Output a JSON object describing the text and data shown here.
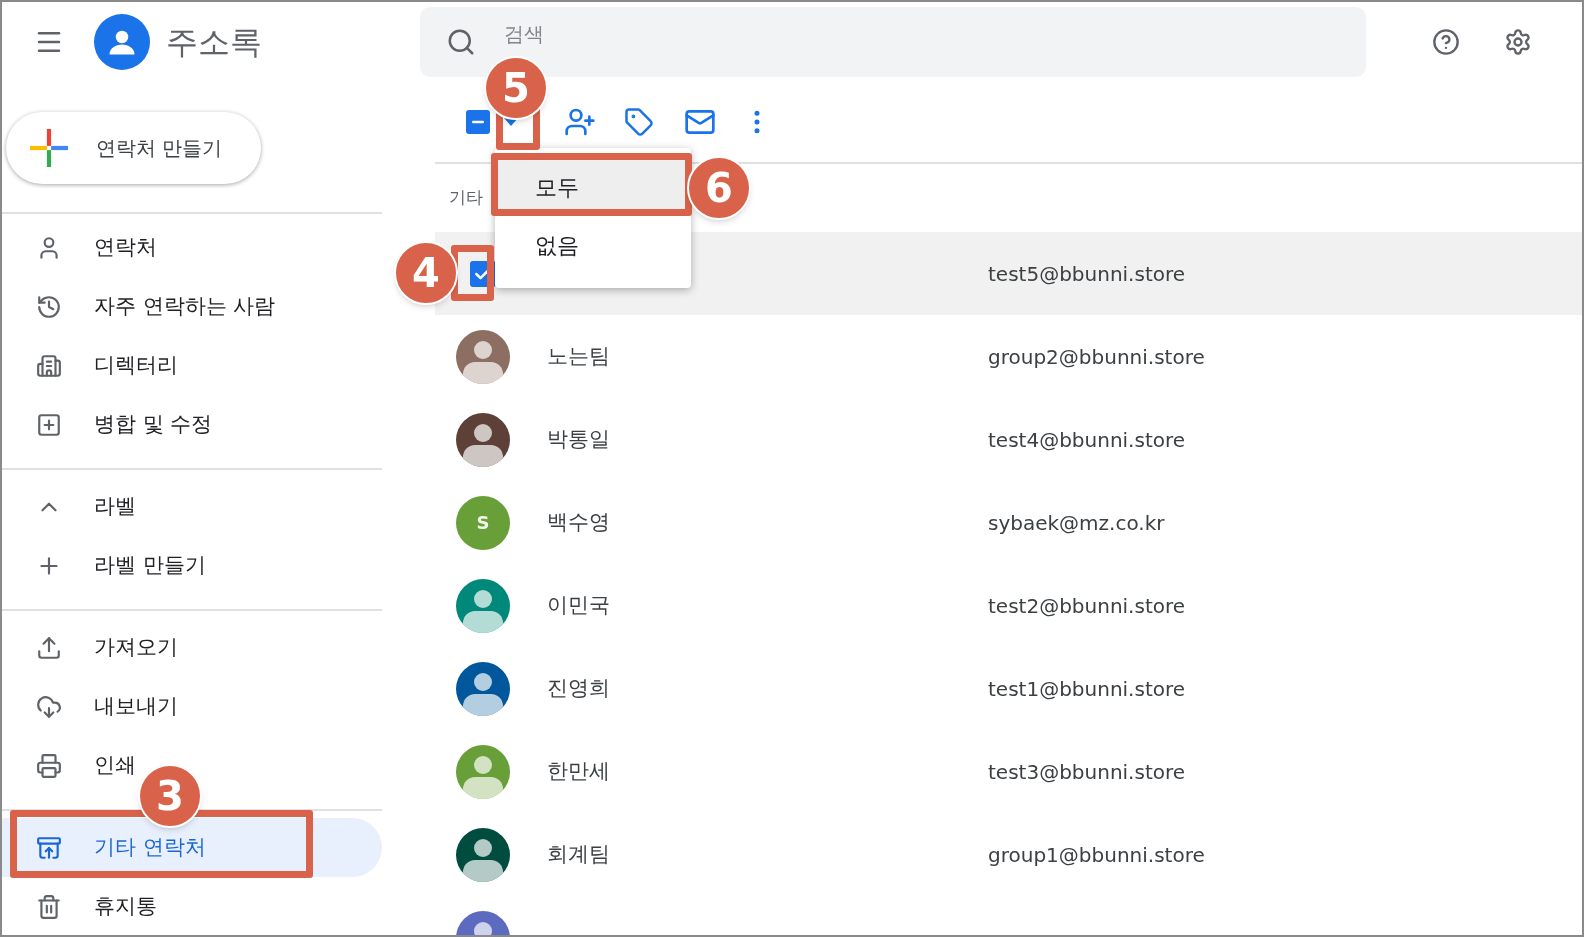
{
  "app": {
    "title": "주소록"
  },
  "search": {
    "placeholder": "검색"
  },
  "create_button": {
    "label": "연락처 만들기"
  },
  "sidebar": {
    "groups": [
      {
        "items": [
          {
            "label": "연락처",
            "selected": false
          },
          {
            "label": "자주 연락하는 사람",
            "selected": false
          },
          {
            "label": "디렉터리",
            "selected": false
          },
          {
            "label": "병합 및 수정",
            "selected": false
          }
        ]
      },
      {
        "items": [
          {
            "label": "라벨",
            "kind": "header",
            "expanded": true,
            "selected": false
          },
          {
            "label": "라벨 만들기",
            "selected": false
          }
        ]
      },
      {
        "items": [
          {
            "label": "가져오기",
            "selected": false
          },
          {
            "label": "내보내기",
            "selected": false
          },
          {
            "label": "인쇄",
            "selected": false
          }
        ]
      },
      {
        "items": [
          {
            "label": "기타 연락처",
            "selected": true
          },
          {
            "label": "휴지통",
            "selected": false
          }
        ]
      }
    ]
  },
  "toolbar": {
    "select_all": {
      "indeterminate": true
    }
  },
  "select_menu": {
    "items": [
      {
        "label": "모두",
        "selected": true
      },
      {
        "label": "없음",
        "selected": false
      }
    ]
  },
  "list": {
    "section": "기타",
    "rows": [
      {
        "selected": true,
        "email": "test5@bbunni.store"
      },
      {
        "selected": false,
        "name": "노는팀",
        "email": "group2@bbunni.store",
        "avatar": {
          "kind": "person",
          "color": "#8d6e63"
        }
      },
      {
        "selected": false,
        "name": "박통일",
        "email": "test4@bbunni.store",
        "avatar": {
          "kind": "person",
          "color": "#5d4037"
        }
      },
      {
        "selected": false,
        "name": "백수영",
        "email": "sybaek@mz.co.kr",
        "avatar": {
          "kind": "initial",
          "initial": "S",
          "color": "#689f38"
        }
      },
      {
        "selected": false,
        "name": "이민국",
        "email": "test2@bbunni.store",
        "avatar": {
          "kind": "person",
          "color": "#00897b"
        }
      },
      {
        "selected": false,
        "name": "진영희",
        "email": "test1@bbunni.store",
        "avatar": {
          "kind": "person",
          "color": "#01579b"
        }
      },
      {
        "selected": false,
        "name": "한만세",
        "email": "test3@bbunni.store",
        "avatar": {
          "kind": "person",
          "color": "#689f38"
        }
      },
      {
        "selected": false,
        "name": "회계팀",
        "email": "group1@bbunni.store",
        "avatar": {
          "kind": "person",
          "color": "#004d40"
        }
      },
      {
        "selected": false,
        "avatar": {
          "kind": "person",
          "color": "#5c6bc0"
        }
      }
    ]
  },
  "callouts": [
    {
      "number": "3"
    },
    {
      "number": "4"
    },
    {
      "number": "5"
    },
    {
      "number": "6"
    }
  ]
}
